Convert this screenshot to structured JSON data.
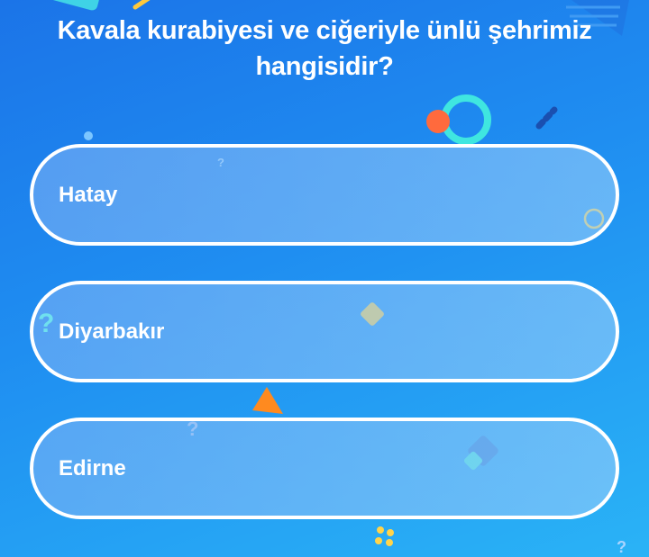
{
  "quiz": {
    "question": "Kavala kurabiyesi ve ciğeriyle ünlü şehrimiz hangisidir?",
    "answers": [
      {
        "label": "Hatay"
      },
      {
        "label": "Diyarbakır"
      },
      {
        "label": "Edirne"
      }
    ]
  },
  "icons": {
    "question_marks": [
      "?",
      "?",
      "?",
      "?"
    ]
  },
  "colors": {
    "background_top": "#1b74e8",
    "background_bottom": "#2ab3f6",
    "answer_border": "#ffffff",
    "text": "#ffffff",
    "accent_orange": "#ff6a3d",
    "accent_teal": "#3fe6e0",
    "accent_yellow": "#ffd44a"
  }
}
